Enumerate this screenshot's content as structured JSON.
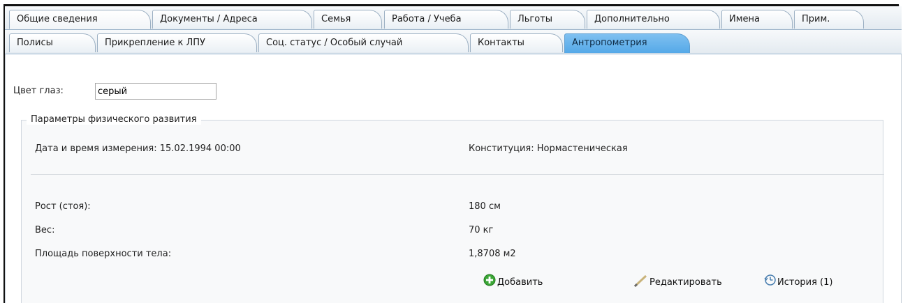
{
  "tabs_primary": [
    {
      "label": "Общие сведения",
      "active": true
    },
    {
      "label": "Документы / Адреса",
      "active": false
    },
    {
      "label": "Семья",
      "active": false
    },
    {
      "label": "Работа / Учеба",
      "active": false
    },
    {
      "label": "Льготы",
      "active": false
    },
    {
      "label": "Дополнительно",
      "active": false
    },
    {
      "label": "Имена",
      "active": false
    },
    {
      "label": "Прим.",
      "active": false
    }
  ],
  "tabs_secondary": [
    {
      "label": "Полисы",
      "active": false
    },
    {
      "label": "Прикрепление к ЛПУ",
      "active": false
    },
    {
      "label": "Соц. статус / Особый случай",
      "active": false
    },
    {
      "label": "Контакты",
      "active": false
    },
    {
      "label": "Антропометрия",
      "active": true
    }
  ],
  "eye_color": {
    "label": "Цвет глаз:",
    "value": "серый"
  },
  "physical": {
    "legend": "Параметры физического развития",
    "measured_label": "Дата и время измерения: 15.02.1994 00:00",
    "constitution_label": "Конституция: Нормастеническая",
    "rows": [
      {
        "label": "Рост (стоя):",
        "value": "180 см"
      },
      {
        "label": "Вес:",
        "value": "70 кг"
      },
      {
        "label": "Площадь поверхности тела:",
        "value": "1,8708 м2"
      }
    ]
  },
  "actions": {
    "add": "Добавить",
    "edit": "Редактировать",
    "history": "История (1)"
  },
  "colors": {
    "active_tab": "#55a9e8",
    "add_icon": "#3aa635"
  }
}
